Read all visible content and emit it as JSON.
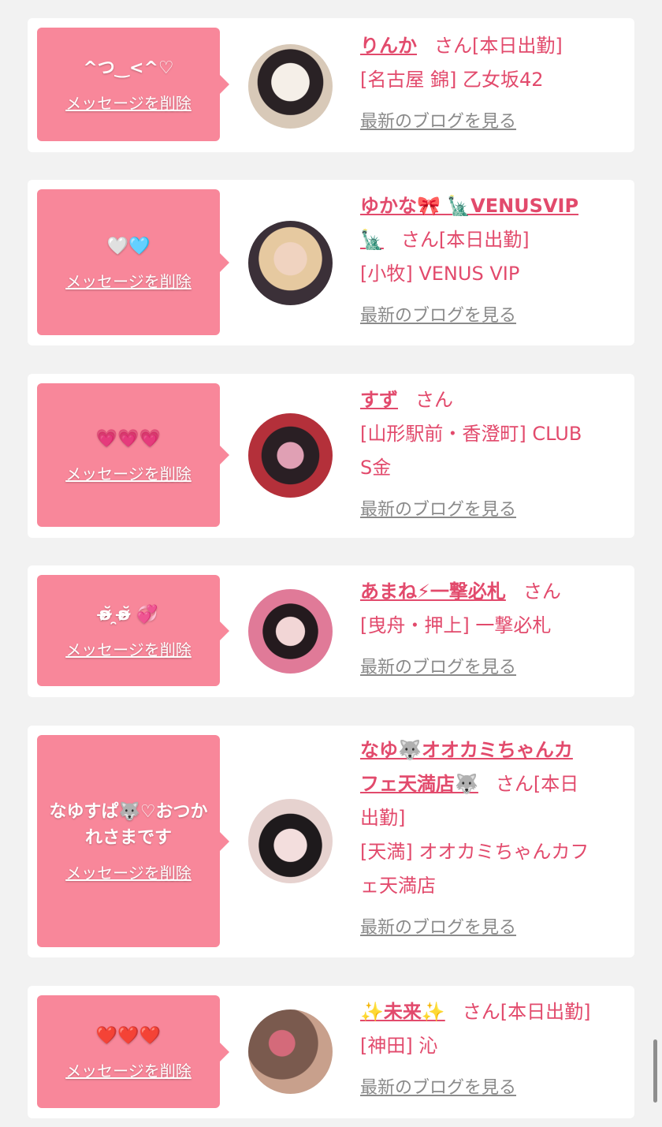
{
  "entries": [
    {
      "message": "^つ‿<^♡",
      "delete_label": "メッセージを削除",
      "name_lines": [
        "りんか"
      ],
      "san": "さん",
      "status": "[本日出勤]",
      "shop_lines": [
        "[名古屋 錦] 乙女坂42"
      ],
      "blog_label": "最新のブログを見る",
      "avatar_colors": [
        "#d8c9b8",
        "#f1ece6"
      ]
    },
    {
      "message": "🤍🩵",
      "delete_label": "メッセージを削除",
      "name_lines": [
        "ゆかな🎀 🗽VENUSVIP",
        "🗽"
      ],
      "san": "さん",
      "status": "[本日出勤]",
      "shop_lines": [
        "[小牧] VENUS VIP"
      ],
      "blog_label": "最新のブログを見る",
      "avatar_colors": [
        "#e6c9a0",
        "#3b3038"
      ]
    },
    {
      "message": "💗💗💗",
      "delete_label": "メッセージを削除",
      "name_lines": [
        "すず"
      ],
      "san": "さん",
      "status": "",
      "shop_lines": [
        "[山形駅前・香澄町] CLUB",
        "S金"
      ],
      "blog_label": "最新のブログを見る",
      "avatar_colors": [
        "#b4303a",
        "#2a1f24"
      ]
    },
    {
      "message": "ʚ̴̶̷̆ ̯ʚ̴̶̷̆ 💞",
      "delete_label": "メッセージを削除",
      "name_lines": [
        "あまね⚡一撃必札"
      ],
      "san": "さん",
      "status": "",
      "shop_lines": [
        "[曳舟・押上] 一撃必札"
      ],
      "blog_label": "最新のブログを見る",
      "avatar_colors": [
        "#e07a98",
        "#241a1e"
      ]
    },
    {
      "message": "なゆすぱ🐺♡おつかれさまです",
      "delete_label": "メッセージを削除",
      "name_lines": [
        "なゆ🐺オオカミちゃんカ",
        "フェ天満店🐺"
      ],
      "san": "さん",
      "status": "[本日",
      "status_cont": "出勤]",
      "shop_lines": [
        "[天満] オオカミちゃんカフ",
        "ェ天満店"
      ],
      "blog_label": "最新のブログを見る",
      "avatar_colors": [
        "#e6d2cf",
        "#1e1a1c"
      ]
    },
    {
      "message": "❤️❤️❤️",
      "delete_label": "メッセージを削除",
      "name_lines": [
        "✨未来✨"
      ],
      "san": "さん",
      "status": "[本日出勤]",
      "shop_lines": [
        "[神田] 沁"
      ],
      "blog_label": "最新のブログを見る",
      "avatar_colors": [
        "#7a5a4e",
        "#c8a08c"
      ]
    }
  ],
  "colors": {
    "accent_pink": "#f8879a",
    "name_text": "#e24a6c",
    "blog_link": "#8a8a8a",
    "background": "#f2f2f2"
  }
}
